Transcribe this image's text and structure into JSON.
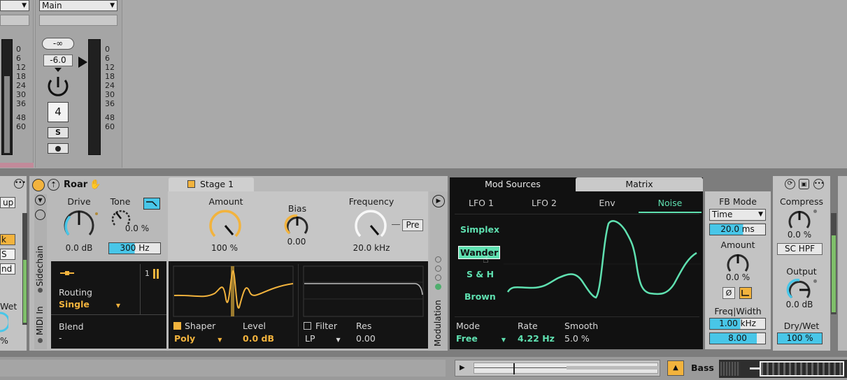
{
  "mixer": {
    "left_dropdown": "",
    "main_dropdown": "Main",
    "neg_inf": "-∞",
    "volume": "-6.0",
    "track_number": "4",
    "solo": "S",
    "scale_left": [
      "0",
      "6",
      "12",
      "18",
      "24",
      "30",
      "36",
      "48",
      "60"
    ],
    "scale_right": [
      "0",
      "6",
      "12",
      "18",
      "24",
      "30",
      "36",
      "48",
      "60"
    ],
    "left_partial_up": "up"
  },
  "roar": {
    "title": "Roar",
    "stage_label": "Stage 1",
    "drive_label": "Drive",
    "drive_value": "0.0 dB",
    "tone_label": "Tone",
    "tone_value": "0.0 %",
    "tone_freq": "300 Hz",
    "amount_label": "Amount",
    "amount_value": "100 %",
    "bias_label": "Bias",
    "bias_value": "0.00",
    "frequency_label": "Frequency",
    "frequency_value": "20.0 kHz",
    "pre_button": "Pre",
    "routing_label": "Routing",
    "routing_value": "Single",
    "routing_num": "1",
    "blend_label": "Blend",
    "blend_value": "-",
    "shaper_label": "Shaper",
    "shaper_value": "Poly",
    "level_label": "Level",
    "level_value": "0.0 dB",
    "filter_label": "Filter",
    "filter_value": "LP",
    "res_label": "Res",
    "res_value": "0.00",
    "sidechain_label": "Sidechain",
    "midi_label": "MIDI In",
    "modulation_label": "Modulation"
  },
  "mod": {
    "tab_mod_sources": "Mod Sources",
    "tab_matrix": "Matrix",
    "sub_tabs": [
      "LFO 1",
      "LFO 2",
      "Env",
      "Noise"
    ],
    "noise_types": [
      "Simplex",
      "Wander",
      "S & H",
      "Brown"
    ],
    "selected_noise": "Wander",
    "mode_label": "Mode",
    "mode_value": "Free",
    "rate_label": "Rate",
    "rate_value": "4.22 Hz",
    "smooth_label": "Smooth",
    "smooth_value": "5.0 %"
  },
  "right": {
    "fb_mode_label": "FB Mode",
    "fb_mode_value": "Time",
    "fb_time": "20.0 ms",
    "amount_label": "Amount",
    "amount_value": "0.0 %",
    "phase_symbol": "Ø",
    "freq_width_label": "Freq|Width",
    "freq_value": "1.00 kHz",
    "width_value": "8.00",
    "compress_label": "Compress",
    "compress_value": "0.0 %",
    "sc_hpf": "SC HPF",
    "output_label": "Output",
    "output_value": "0.0 dB",
    "drywet_label": "Dry/Wet",
    "drywet_value": "100 %"
  },
  "left_partial": {
    "x1": "k",
    "x2": "S",
    "x3": "nd",
    "wet": "Wet",
    "pct": "%"
  },
  "bottom": {
    "track_name": "Bass"
  },
  "colors": {
    "accent_orange": "#f2b33d",
    "accent_cyan": "#48c6e8",
    "mint": "#5fe0b0",
    "mod_bg": "#111111"
  }
}
